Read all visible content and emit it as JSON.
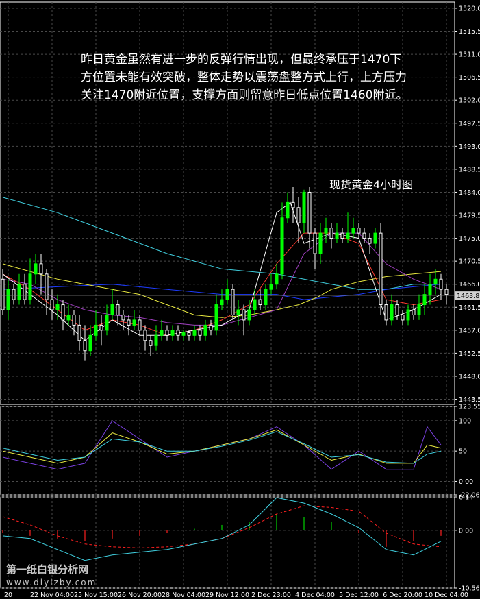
{
  "commentary": "昨日黄金虽然有进一步的反弹行情出现，但最终承压于1470下方位置未能有效突破，整体走势以震荡盘整方式上行，上方压力关注1470附近位置，支撑方面则留意昨日低点位置1460附近。",
  "subtitle": "现货黄金4小时图",
  "watermark": {
    "line1": "第一纸白银分析网",
    "line2": "www.diyizby.com"
  },
  "colors": {
    "background": "#000000",
    "grid": "#4a4a4a",
    "axis": "#ffffff",
    "bull": "#00ff00",
    "bear": "#ffffff",
    "ma_fast": "#ff3b30",
    "ma_purple": "#a040c0",
    "ma_yellow": "#e8e840",
    "ma_blue": "#1e3cff",
    "ma_cyan": "#40d0e0",
    "price_line": "#ffffff",
    "stoch_main": "#7a40e0",
    "stoch_mid": "#e8e840",
    "stoch_signal": "#40d0e0",
    "macd_hist_pos": "#00d000",
    "macd_hist_neg": "#ff2020",
    "macd_signal": "#ff2020",
    "macd_line": "#40d0e0",
    "price_tag_bg": "#d0d0d0"
  },
  "chart_data": [
    {
      "type": "candlestick",
      "panel": "price",
      "ylim": [
        1442.5,
        1521.2
      ],
      "y_ticks": [
        "1520.0",
        "1515.5",
        "1511.0",
        "1506.5",
        "1502.0",
        "1497.5",
        "1493.0",
        "1488.5",
        "1484.0",
        "1479.5",
        "1475.0",
        "1470.5",
        "1466.0",
        "1461.5",
        "1457.0",
        "1452.5",
        "1448.0",
        "1443.5"
      ],
      "current_price": "1463.8",
      "candles": [
        [
          1467,
          1461,
          1469,
          1460
        ],
        [
          1461,
          1465,
          1467,
          1459
        ],
        [
          1465,
          1463,
          1466,
          1462
        ],
        [
          1463,
          1466,
          1468,
          1462
        ],
        [
          1466,
          1463,
          1468,
          1462
        ],
        [
          1463,
          1468,
          1471,
          1462
        ],
        [
          1468,
          1470,
          1472,
          1466
        ],
        [
          1470,
          1468,
          1472,
          1464
        ],
        [
          1468,
          1463,
          1469,
          1460
        ],
        [
          1463,
          1461,
          1465,
          1459
        ],
        [
          1461,
          1462,
          1464,
          1459
        ],
        [
          1462,
          1459,
          1463,
          1457
        ],
        [
          1459,
          1460,
          1462,
          1458
        ],
        [
          1460,
          1458,
          1461,
          1456
        ],
        [
          1458,
          1455,
          1460,
          1453
        ],
        [
          1455,
          1453,
          1458,
          1451
        ],
        [
          1453,
          1456,
          1458,
          1452
        ],
        [
          1456,
          1458,
          1461,
          1455
        ],
        [
          1458,
          1457,
          1460,
          1454
        ],
        [
          1457,
          1460,
          1462,
          1456
        ],
        [
          1460,
          1462,
          1465,
          1459
        ],
        [
          1462,
          1460,
          1463,
          1458
        ],
        [
          1460,
          1459,
          1461,
          1457
        ],
        [
          1459,
          1458,
          1460,
          1456
        ],
        [
          1458,
          1459,
          1461,
          1457
        ],
        [
          1459,
          1457,
          1460,
          1456
        ],
        [
          1457,
          1455,
          1458,
          1453
        ],
        [
          1455,
          1454,
          1456,
          1452
        ],
        [
          1454,
          1456,
          1458,
          1453
        ],
        [
          1456,
          1457,
          1459,
          1455
        ],
        [
          1457,
          1456,
          1458,
          1455
        ],
        [
          1456,
          1457,
          1458,
          1455
        ],
        [
          1457,
          1456,
          1458,
          1455
        ],
        [
          1456,
          1456.5,
          1457,
          1455
        ],
        [
          1456.5,
          1456,
          1457,
          1455
        ],
        [
          1456,
          1457,
          1458,
          1455
        ],
        [
          1457,
          1456,
          1458,
          1455
        ],
        [
          1456,
          1458,
          1459,
          1455
        ],
        [
          1458,
          1457,
          1459,
          1456
        ],
        [
          1457,
          1462,
          1464,
          1456
        ],
        [
          1462,
          1463,
          1465,
          1461
        ],
        [
          1463,
          1465,
          1467,
          1462
        ],
        [
          1465,
          1460,
          1466,
          1459
        ],
        [
          1460,
          1461,
          1463,
          1458
        ],
        [
          1461,
          1459,
          1462,
          1456
        ],
        [
          1459,
          1461,
          1463,
          1458
        ],
        [
          1461,
          1463,
          1465,
          1460
        ],
        [
          1463,
          1462,
          1465,
          1461
        ],
        [
          1462,
          1465,
          1466,
          1461
        ],
        [
          1465,
          1466,
          1468,
          1464
        ],
        [
          1466,
          1468,
          1470,
          1465
        ],
        [
          1468,
          1479,
          1482,
          1467
        ],
        [
          1479,
          1482,
          1484,
          1478
        ],
        [
          1482,
          1481,
          1485,
          1478
        ],
        [
          1481,
          1478,
          1483,
          1474
        ],
        [
          1478,
          1484,
          1484.5,
          1476
        ],
        [
          1484,
          1476,
          1485,
          1473
        ],
        [
          1476,
          1472,
          1477,
          1469
        ],
        [
          1472,
          1476,
          1478,
          1470
        ],
        [
          1476,
          1477,
          1479,
          1474
        ],
        [
          1477,
          1475,
          1478,
          1473
        ],
        [
          1475,
          1476,
          1478,
          1474
        ],
        [
          1476,
          1475,
          1477,
          1474
        ],
        [
          1475,
          1476,
          1480,
          1474
        ],
        [
          1476,
          1477,
          1479,
          1475
        ],
        [
          1477,
          1476,
          1478,
          1475
        ],
        [
          1476,
          1475,
          1477,
          1474
        ],
        [
          1475,
          1474,
          1476,
          1472
        ],
        [
          1474,
          1476,
          1477,
          1473
        ],
        [
          1476,
          1462,
          1478,
          1460
        ],
        [
          1462,
          1459,
          1463,
          1458
        ],
        [
          1459,
          1462,
          1464,
          1458
        ],
        [
          1462,
          1460,
          1463,
          1459
        ],
        [
          1460,
          1459,
          1461,
          1458
        ],
        [
          1459,
          1461,
          1462,
          1458
        ],
        [
          1461,
          1460,
          1462,
          1459
        ],
        [
          1460,
          1462,
          1464,
          1459
        ],
        [
          1462,
          1464,
          1466,
          1460
        ],
        [
          1464,
          1466,
          1468,
          1462
        ],
        [
          1466,
          1467,
          1469,
          1464
        ],
        [
          1467,
          1465,
          1468,
          1463
        ],
        [
          1465,
          1464,
          1466,
          1462
        ]
      ],
      "moving_averages": [
        {
          "color": "ma_cyan",
          "points": [
            [
              0,
              1483
            ],
            [
              20,
              1480
            ],
            [
              40,
              1476
            ],
            [
              60,
              1472
            ],
            [
              80,
              1469
            ],
            [
              100,
              1468
            ],
            [
              110,
              1467
            ],
            [
              120,
              1466
            ],
            [
              130,
              1465
            ],
            [
              140,
              1465
            ],
            [
              150,
              1466
            ],
            [
              160,
              1466
            ]
          ]
        },
        {
          "color": "ma_blue",
          "points": [
            [
              0,
              1465
            ],
            [
              20,
              1465.5
            ],
            [
              40,
              1466
            ],
            [
              60,
              1465
            ],
            [
              80,
              1464
            ],
            [
              100,
              1464
            ],
            [
              110,
              1463
            ],
            [
              120,
              1463.5
            ],
            [
              130,
              1464
            ],
            [
              140,
              1465
            ],
            [
              150,
              1465.5
            ],
            [
              160,
              1466
            ]
          ]
        },
        {
          "color": "ma_yellow",
          "points": [
            [
              0,
              1470
            ],
            [
              20,
              1467
            ],
            [
              30,
              1466
            ],
            [
              40,
              1465
            ],
            [
              50,
              1464
            ],
            [
              60,
              1462
            ],
            [
              70,
              1460
            ],
            [
              80,
              1459.5
            ],
            [
              90,
              1460
            ],
            [
              100,
              1461
            ],
            [
              108,
              1462
            ],
            [
              115,
              1463.5
            ],
            [
              120,
              1465
            ],
            [
              130,
              1466.5
            ],
            [
              140,
              1467.5
            ],
            [
              150,
              1468
            ],
            [
              160,
              1468.5
            ]
          ]
        },
        {
          "color": "ma_purple",
          "points": [
            [
              0,
              1467
            ],
            [
              10,
              1466
            ],
            [
              20,
              1463
            ],
            [
              30,
              1461
            ],
            [
              40,
              1460
            ],
            [
              50,
              1459.5
            ],
            [
              60,
              1458.5
            ],
            [
              70,
              1458
            ],
            [
              80,
              1458
            ],
            [
              90,
              1459.5
            ],
            [
              100,
              1461
            ],
            [
              110,
              1472
            ],
            [
              120,
              1476
            ],
            [
              130,
              1476
            ],
            [
              140,
              1470
            ],
            [
              150,
              1467
            ],
            [
              160,
              1465
            ]
          ]
        },
        {
          "color": "ma_fast",
          "points": [
            [
              0,
              1468
            ],
            [
              10,
              1465
            ],
            [
              20,
              1461
            ],
            [
              30,
              1457
            ],
            [
              40,
              1459
            ],
            [
              50,
              1458
            ],
            [
              60,
              1456
            ],
            [
              70,
              1457
            ],
            [
              80,
              1459
            ],
            [
              90,
              1462
            ],
            [
              100,
              1470
            ],
            [
              110,
              1476
            ],
            [
              120,
              1476
            ],
            [
              130,
              1474
            ],
            [
              140,
              1463
            ],
            [
              150,
              1462
            ],
            [
              160,
              1463
            ]
          ]
        },
        {
          "color": "price_line",
          "points": [
            [
              0,
              1468
            ],
            [
              10,
              1464
            ],
            [
              20,
              1460
            ],
            [
              30,
              1455
            ],
            [
              40,
              1459
            ],
            [
              50,
              1456
            ],
            [
              60,
              1456
            ],
            [
              70,
              1457
            ],
            [
              80,
              1458
            ],
            [
              90,
              1461
            ],
            [
              100,
              1480
            ],
            [
              105,
              1482
            ],
            [
              110,
              1474
            ],
            [
              120,
              1476
            ],
            [
              130,
              1475
            ],
            [
              140,
              1459
            ],
            [
              150,
              1461
            ],
            [
              160,
              1464
            ]
          ]
        }
      ]
    },
    {
      "type": "line",
      "panel": "oscillator",
      "ylim": [
        -22.061,
        123.557
      ],
      "y_ticks": [
        "123.557",
        "100",
        "50",
        "0.00",
        "-22.061"
      ],
      "series": [
        {
          "color": "stoch_main",
          "x": [
            0,
            10,
            20,
            30,
            40,
            50,
            60,
            70,
            80,
            90,
            100,
            110,
            120,
            130,
            140,
            150,
            155,
            160
          ],
          "values": [
            40,
            30,
            20,
            30,
            100,
            70,
            40,
            50,
            60,
            70,
            90,
            60,
            20,
            50,
            20,
            20,
            90,
            60
          ]
        },
        {
          "color": "stoch_mid",
          "x": [
            0,
            10,
            20,
            30,
            40,
            50,
            60,
            70,
            80,
            90,
            100,
            110,
            120,
            130,
            140,
            150,
            155,
            160
          ],
          "values": [
            50,
            40,
            30,
            40,
            80,
            65,
            45,
            50,
            60,
            70,
            85,
            60,
            35,
            45,
            30,
            30,
            60,
            55
          ]
        },
        {
          "color": "stoch_signal",
          "x": [
            0,
            10,
            20,
            30,
            40,
            50,
            60,
            70,
            80,
            90,
            100,
            110,
            120,
            130,
            140,
            150,
            155,
            160
          ],
          "values": [
            55,
            45,
            35,
            40,
            70,
            65,
            50,
            50,
            58,
            68,
            82,
            62,
            40,
            44,
            32,
            30,
            45,
            50
          ]
        }
      ]
    },
    {
      "type": "bar",
      "panel": "macd",
      "ylim": [
        -10.56,
        6.14
      ],
      "y_ticks": [
        "6.14",
        "0.00",
        "-10.56"
      ],
      "histogram": {
        "x": [
          0,
          10,
          20,
          30,
          40,
          50,
          60,
          70,
          80,
          90,
          100,
          110,
          120,
          130,
          140,
          150,
          160
        ],
        "values": [
          -0.5,
          -1.0,
          -1.5,
          -2.0,
          -1.5,
          -1.0,
          -0.5,
          0.3,
          1.0,
          1.5,
          3.0,
          2.5,
          1.5,
          -0.5,
          -3.0,
          -2.0,
          -1.0
        ]
      },
      "series": [
        {
          "color": "macd_signal",
          "x": [
            0,
            10,
            20,
            30,
            40,
            50,
            60,
            70,
            80,
            90,
            100,
            110,
            120,
            130,
            140,
            150,
            160
          ],
          "values": [
            2.5,
            1.0,
            -1.0,
            -2.5,
            -3.0,
            -3.2,
            -3.0,
            -2.5,
            -1.5,
            0.5,
            3.0,
            4.5,
            4.2,
            3.5,
            -0.5,
            -2.5,
            -3.0
          ]
        },
        {
          "color": "macd_line",
          "x": [
            0,
            10,
            20,
            30,
            40,
            50,
            60,
            70,
            80,
            90,
            100,
            110,
            120,
            130,
            140,
            150,
            160
          ],
          "values": [
            -1.0,
            -1.5,
            -3.5,
            -5.5,
            -4.5,
            -4.0,
            -3.5,
            -2.5,
            -1.5,
            1.0,
            6.0,
            5.0,
            3.0,
            0.5,
            -3.5,
            -4.5,
            -2.0
          ]
        }
      ]
    }
  ],
  "x_labels": [
    "20",
    "22 Nov 04:00",
    "25 Nov 15:00",
    "26 Nov 20:00",
    "28 Nov 04:00",
    "29 Nov 12:00",
    "2 Dec 23:00",
    "4 Dec 04:00",
    "5 Dec 12:00",
    "6 Dec 20:00",
    "10 Dec 04:00"
  ]
}
